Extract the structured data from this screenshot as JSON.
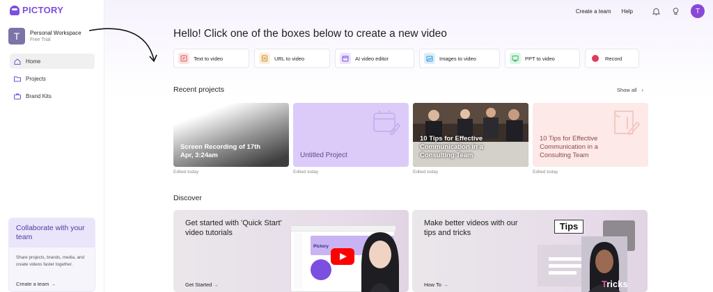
{
  "brand": {
    "logo_text": "PICTORY",
    "accent": "#7b4fe0"
  },
  "workspace": {
    "initial": "T",
    "name": "Personal Workspace",
    "plan": "Free Trial"
  },
  "nav": [
    {
      "label": "Home",
      "icon": "home-icon",
      "active": true
    },
    {
      "label": "Projects",
      "icon": "folder-icon",
      "active": false
    },
    {
      "label": "Brand Kits",
      "icon": "briefcase-icon",
      "active": false
    }
  ],
  "collab": {
    "title": "Collaborate with your team",
    "body": "Share projects, brands, media, and create videos faster together.",
    "link": "Create a team",
    "arrow": "→"
  },
  "topbar": {
    "create_team": "Create a team",
    "help": "Help",
    "user_initial": "T"
  },
  "headline": "Hello! Click one of the boxes below to create a new video",
  "create_options": [
    {
      "label": "Text to video",
      "icon": "text-video-icon",
      "color": "#fde3e3",
      "fg": "#d9534f"
    },
    {
      "label": "URL to video",
      "icon": "url-video-icon",
      "color": "#fcefd9",
      "fg": "#c98a2b"
    },
    {
      "label": "AI video editor",
      "icon": "ai-editor-icon",
      "color": "#ece4fb",
      "fg": "#7b4fe0"
    },
    {
      "label": "Images to video",
      "icon": "images-video-icon",
      "color": "#dbeefc",
      "fg": "#2d8fd6"
    },
    {
      "label": "PPT to video",
      "icon": "ppt-video-icon",
      "color": "#dcf5e4",
      "fg": "#2fae62"
    },
    {
      "label": "Record",
      "icon": "record-icon",
      "color": "#ffffff",
      "fg": "#e03c5a"
    }
  ],
  "recent": {
    "title": "Recent projects",
    "show_all": "Show all",
    "projects": [
      {
        "title": "Screen Recording of 17th Apr, 3:24am",
        "edited": "Edited today"
      },
      {
        "title": "Untitled Project",
        "edited": "Edited today"
      },
      {
        "title": "10 Tips for Effective Communication in a Consulting Team",
        "edited": "Edited today"
      },
      {
        "title": "10 Tips for Effective Communication in a Consulting Team",
        "edited": "Edited today"
      }
    ]
  },
  "discover": {
    "title": "Discover",
    "cards": [
      {
        "title": "Get started with 'Quick Start' video tutorials",
        "link": "Get Started",
        "badge": "Pictory"
      },
      {
        "title": "Make better videos with our tips and tricks",
        "link": "How To",
        "overlay_top": "Tips",
        "overlay_bottom_a": "T",
        "overlay_bottom_b": "ricks"
      }
    ]
  }
}
